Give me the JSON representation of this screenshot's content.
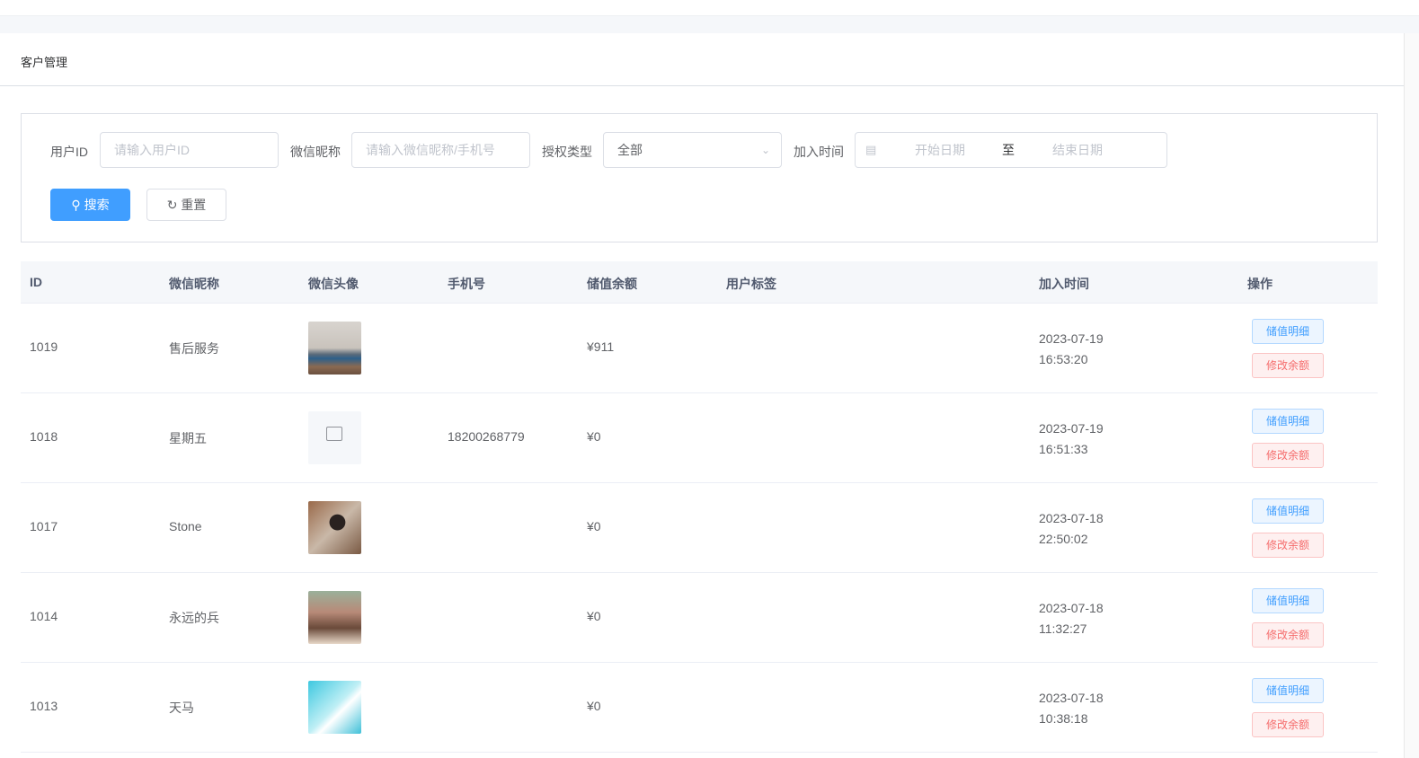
{
  "page_title": "客户管理",
  "filters": {
    "user_id": {
      "label": "用户ID",
      "placeholder": "请输入用户ID"
    },
    "nickname": {
      "label": "微信昵称",
      "placeholder": "请输入微信昵称/手机号"
    },
    "auth_type": {
      "label": "授权类型",
      "value": "全部"
    },
    "join_time": {
      "label": "加入时间",
      "start_placeholder": "开始日期",
      "separator": "至",
      "end_placeholder": "结束日期"
    },
    "search_label": "搜索",
    "reset_label": "重置"
  },
  "table": {
    "columns": [
      "ID",
      "微信昵称",
      "微信头像",
      "手机号",
      "储值余额",
      "用户标签",
      "加入时间",
      "操作"
    ],
    "action_detail": "储值明细",
    "action_edit": "修改余额",
    "rows": [
      {
        "id": "1019",
        "nickname": "售后服务",
        "avatar": "car-photo",
        "phone": "",
        "balance": "¥911",
        "tags": "",
        "date": "2023-07-19",
        "time": "16:53:20"
      },
      {
        "id": "1018",
        "nickname": "星期五",
        "avatar": "placeholder",
        "phone": "18200268779",
        "balance": "¥0",
        "tags": "",
        "date": "2023-07-19",
        "time": "16:51:33"
      },
      {
        "id": "1017",
        "nickname": "Stone",
        "avatar": "person-photo",
        "phone": "",
        "balance": "¥0",
        "tags": "",
        "date": "2023-07-18",
        "time": "22:50:02"
      },
      {
        "id": "1014",
        "nickname": "永远的兵",
        "avatar": "soldiers-photo",
        "phone": "",
        "balance": "¥0",
        "tags": "",
        "date": "2023-07-18",
        "time": "11:32:27"
      },
      {
        "id": "1013",
        "nickname": "天马",
        "avatar": "anime-photo",
        "phone": "",
        "balance": "¥0",
        "tags": "",
        "date": "2023-07-18",
        "time": "10:38:18"
      }
    ]
  },
  "colors": {
    "primary": "#409eff",
    "danger": "#f56c6c"
  }
}
